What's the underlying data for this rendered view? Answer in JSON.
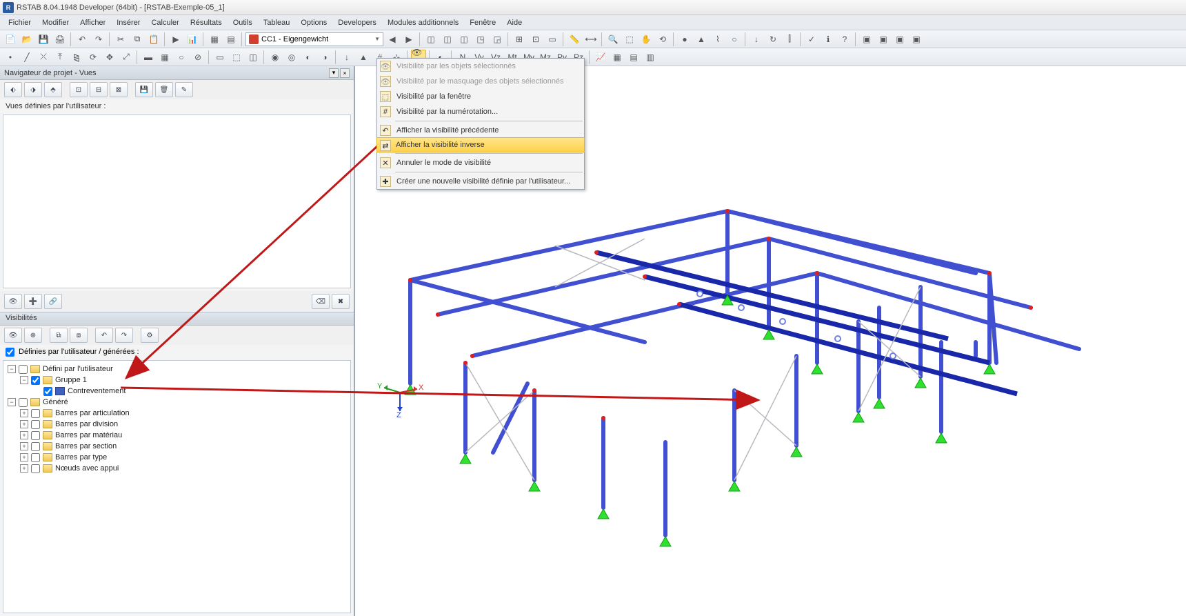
{
  "window": {
    "title": "RSTAB 8.04.1948 Developer (64bit) - [RSTAB-Exemple-05_1]"
  },
  "menus": [
    "Fichier",
    "Modifier",
    "Afficher",
    "Insérer",
    "Calculer",
    "Résultats",
    "Outils",
    "Tableau",
    "Options",
    "Developers",
    "Modules additionnels",
    "Fenêtre",
    "Aide"
  ],
  "load_combo": {
    "value": "CC1 - Eigengewicht"
  },
  "navigator": {
    "title": "Navigateur de projet - Vues",
    "user_views_label": "Vues définies par l'utilisateur :"
  },
  "visibilities": {
    "header": "Visibilités",
    "checkbox_label": "Définies par l'utilisateur / générées :",
    "tree": {
      "user_defined": "Défini par l'utilisateur",
      "group1": "Gruppe 1",
      "contreventement": "Contreventement",
      "generated": "Généré",
      "items": [
        "Barres par articulation",
        "Barres par division",
        "Barres par matériau",
        "Barres par section",
        "Barres par type",
        "Nœuds avec appui"
      ]
    }
  },
  "dropdown": {
    "items": [
      {
        "label": "Visibilité par les objets sélectionnés",
        "disabled": true
      },
      {
        "label": "Visibilité par le masquage des objets sélectionnés",
        "disabled": true
      },
      {
        "label": "Visibilité par la fenêtre",
        "disabled": false
      },
      {
        "label": "Visibilité par la numérotation...",
        "disabled": false
      }
    ],
    "items2": [
      {
        "label": "Afficher la visibilité précédente",
        "disabled": false
      },
      {
        "label": "Afficher la visibilité inverse",
        "disabled": false,
        "highlight": true
      }
    ],
    "items3": [
      {
        "label": "Annuler le mode de visibilité",
        "disabled": false
      }
    ],
    "items4": [
      {
        "label": "Créer une nouvelle visibilité définie par l'utilisateur...",
        "disabled": false
      }
    ]
  },
  "axes": {
    "x": "X",
    "y": "Y",
    "z": "Z"
  }
}
